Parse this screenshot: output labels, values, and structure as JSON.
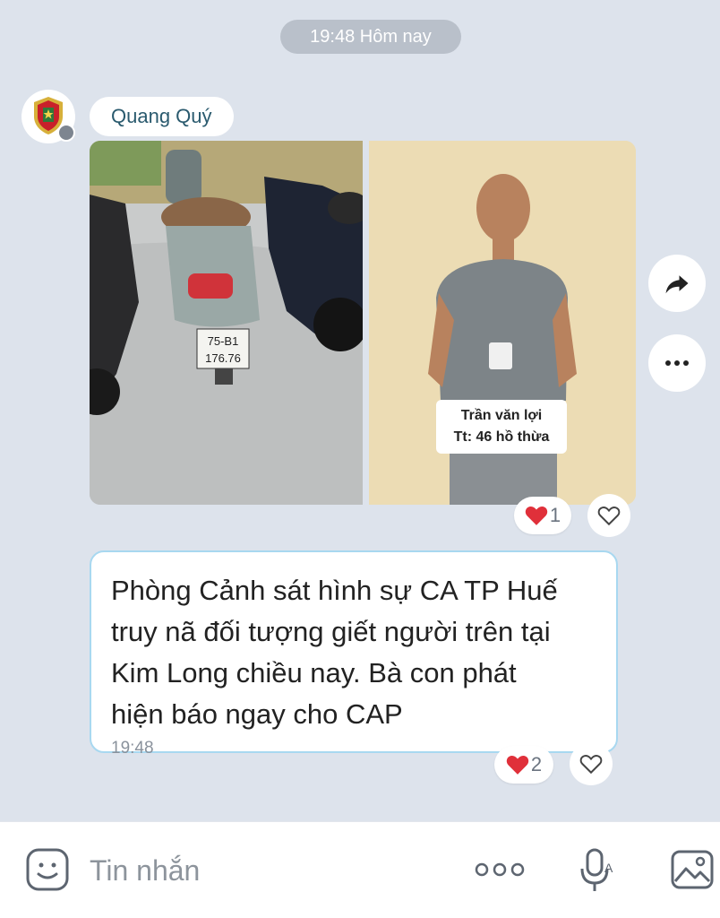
{
  "chat": {
    "date_divider": "19:48 Hôm nay",
    "sender": {
      "name": "Quang Quý",
      "avatar_icon": "police-emblem-icon"
    }
  },
  "image_message": {
    "caption_line1": "Trần văn lợi",
    "caption_line2": "Tt: 46 hồ thừa",
    "plate_line1": "75-B1",
    "plate_line2": "176.76",
    "reaction_count": "1"
  },
  "text_message": {
    "text": "Phòng Cảnh sát hình sự CA TP Huế\ntruy nã đối tượng giết người trên tại\nKim Long chiều nay. Bà con phát\nhiện báo ngay cho CAP",
    "time": "19:48",
    "reaction_count": "2"
  },
  "side_actions": [
    "share-icon",
    "more-icon"
  ],
  "composer": {
    "placeholder": "Tin nhắn",
    "icons": [
      "sticker-icon",
      "more-dots-icon",
      "voice-icon",
      "image-icon"
    ]
  },
  "colors": {
    "background": "#dde3ec",
    "bubble_border": "#a8d8f0",
    "heart": "#e0303a",
    "sender_name": "#2a5a6e"
  }
}
